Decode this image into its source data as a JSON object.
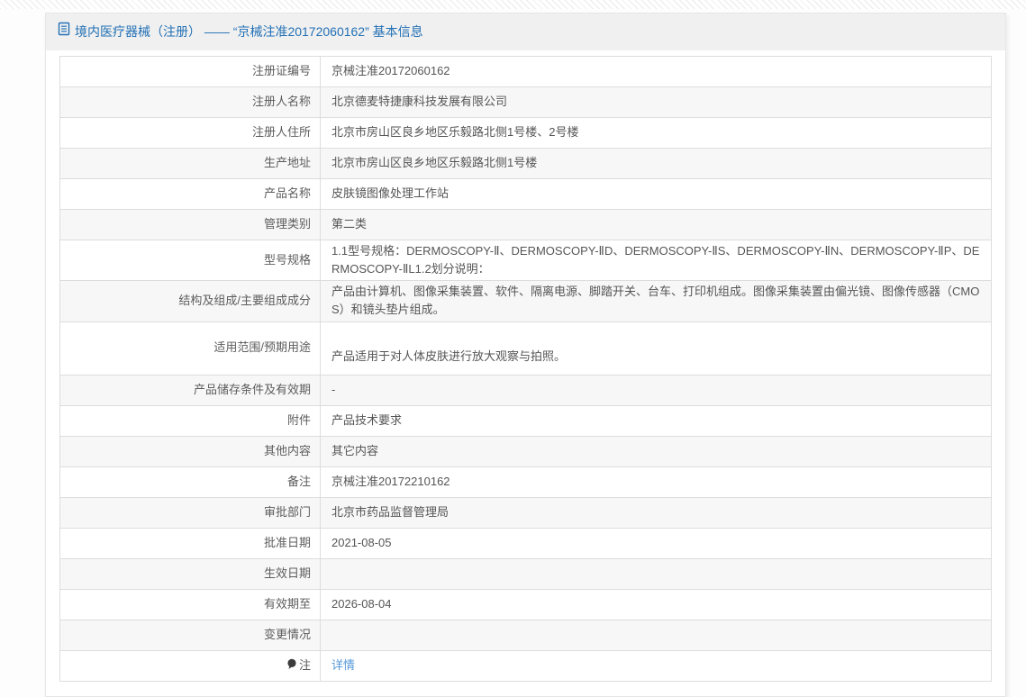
{
  "page": {
    "title": "境内医疗器械（注册） —— “京械注准20172060162” 基本信息",
    "title_icon": "document-icon"
  },
  "colors": {
    "title_blue": "#2270b5",
    "link_blue": "#5598d8",
    "header_bg": "#f0f0f0",
    "alt_row_bg": "#f7f7f7",
    "border": "#dddddd"
  },
  "table": {
    "rows": [
      {
        "label": "注册证编号",
        "value": "京械注准20172060162"
      },
      {
        "label": "注册人名称",
        "value": "北京德麦特捷康科技发展有限公司"
      },
      {
        "label": "注册人住所",
        "value": "北京市房山区良乡地区乐毅路北侧1号楼、2号楼"
      },
      {
        "label": "生产地址",
        "value": "北京市房山区良乡地区乐毅路北侧1号楼"
      },
      {
        "label": "产品名称",
        "value": "皮肤镜图像处理工作站"
      },
      {
        "label": "管理类别",
        "value": "第二类"
      },
      {
        "label": "型号规格",
        "value": "1.1型号规格：DERMOSCOPY-Ⅱ、DERMOSCOPY-ⅡD、DERMOSCOPY-ⅡS、DERMOSCOPY-ⅡN、DERMOSCOPY-ⅡP、DERMOSCOPY-ⅡL1.2划分说明："
      },
      {
        "label": "结构及组成/主要组成成分",
        "value": "产品由计算机、图像采集装置、软件、隔离电源、脚踏开关、台车、打印机组成。图像采集装置由偏光镜、图像传感器（CMOS）和镜头垫片组成。"
      },
      {
        "label": "适用范围/预期用途",
        "value": "产品适用于对人体皮肤进行放大观察与拍照。",
        "style": "value-low"
      },
      {
        "label": "产品储存条件及有效期",
        "value": "-"
      },
      {
        "label": "附件",
        "value": "产品技术要求"
      },
      {
        "label": "其他内容",
        "value": "其它内容"
      },
      {
        "label": "备注",
        "value": "京械注准20172210162"
      },
      {
        "label": "审批部门",
        "value": "北京市药品监督管理局"
      },
      {
        "label": "批准日期",
        "value": "2021-08-05"
      },
      {
        "label": "生效日期",
        "value": ""
      },
      {
        "label": "有效期至",
        "value": "2026-08-04"
      },
      {
        "label": "变更情况",
        "value": ""
      },
      {
        "label": "注",
        "value": "详情",
        "label_icon": "balloon-icon",
        "value_type": "link"
      }
    ]
  }
}
